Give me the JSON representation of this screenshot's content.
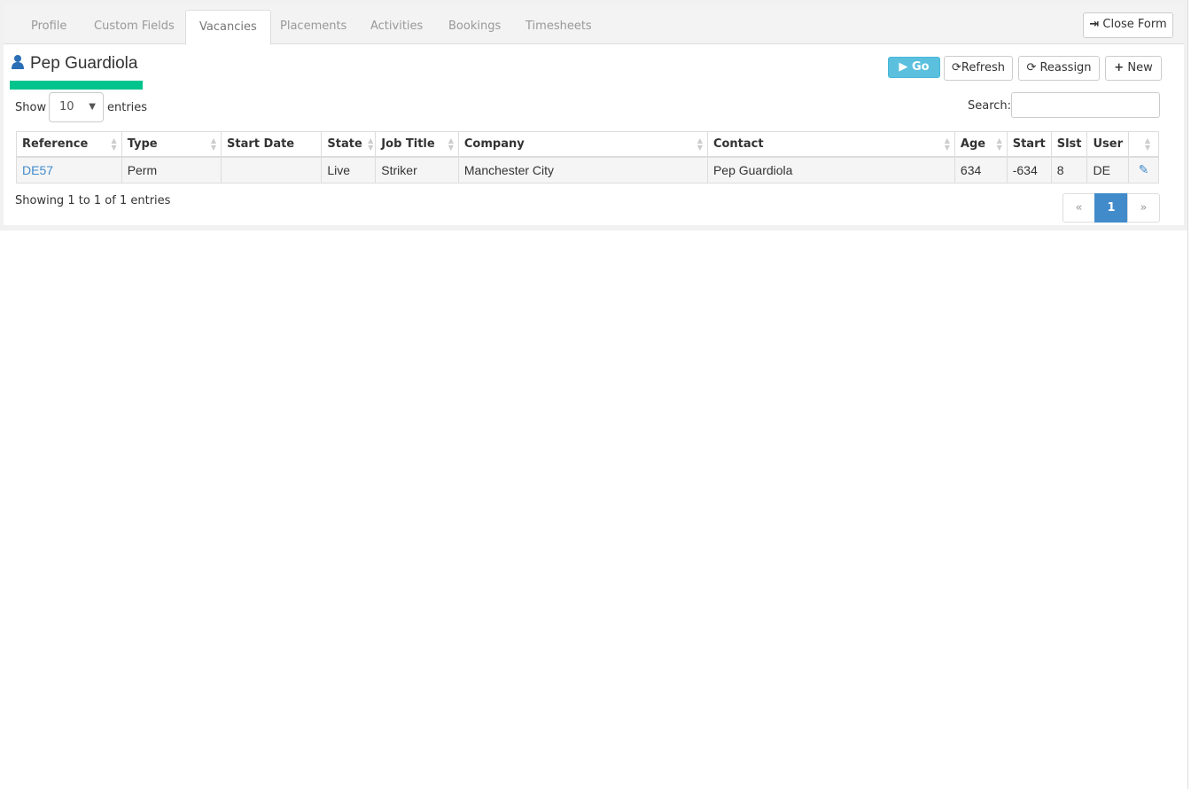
{
  "tabs": [
    {
      "label": "Profile"
    },
    {
      "label": "Custom Fields"
    },
    {
      "label": "Vacancies",
      "active": true
    },
    {
      "label": "Placements"
    },
    {
      "label": "Activities"
    },
    {
      "label": "Bookings"
    },
    {
      "label": "Timesheets"
    }
  ],
  "close_form": "Close Form",
  "title": "Pep Guardiola",
  "toolbar": {
    "go": "Go",
    "refresh": "Refresh",
    "reassign": "Reassign",
    "new": "New"
  },
  "length": {
    "show": "Show",
    "value": "10",
    "entries": "entries"
  },
  "search": {
    "label": "Search:",
    "value": ""
  },
  "table": {
    "headers": [
      "Reference",
      "Type",
      "Start Date",
      "State",
      "Job Title",
      "Company",
      "Contact",
      "Age",
      "Start",
      "Slst",
      "User",
      ""
    ],
    "rows": [
      [
        "DE57",
        "Perm",
        "",
        "Live",
        "Striker",
        "Manchester City",
        "Pep Guardiola",
        "634",
        "-634",
        "8",
        "DE"
      ]
    ]
  },
  "info": "Showing 1 to 1 of 1 entries",
  "pagination": {
    "prev": "«",
    "page": "1",
    "next": "»"
  },
  "colors": {
    "accent": "#00c48c",
    "primary": "#428bca",
    "go": "#5bc0de",
    "link": "#428bca"
  }
}
